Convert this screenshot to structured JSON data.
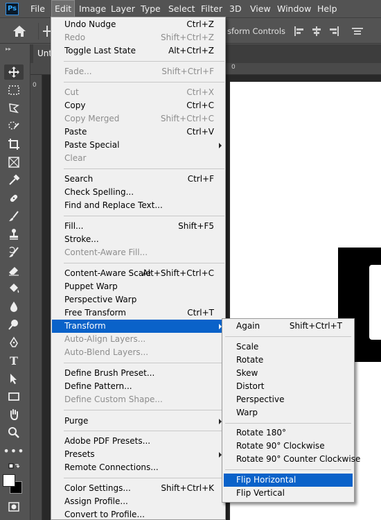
{
  "app": {
    "logo": "Ps"
  },
  "menubar": {
    "items": [
      "File",
      "Edit",
      "Image",
      "Layer",
      "Type",
      "Select",
      "Filter",
      "3D",
      "View",
      "Window",
      "Help"
    ]
  },
  "options_bar": {
    "transform_controls": "sform Controls"
  },
  "tab": {
    "title": "Unti"
  },
  "rulers": {
    "left_zero": "0",
    "top_zero": "0"
  },
  "edit_menu": {
    "items": [
      {
        "label": "Undo Nudge",
        "shortcut": "Ctrl+Z",
        "enabled": true
      },
      {
        "label": "Redo",
        "shortcut": "Shift+Ctrl+Z",
        "enabled": false
      },
      {
        "label": "Toggle Last State",
        "shortcut": "Alt+Ctrl+Z",
        "enabled": true
      },
      {
        "label": "Fade...",
        "shortcut": "Shift+Ctrl+F",
        "enabled": false
      },
      {
        "label": "Cut",
        "shortcut": "Ctrl+X",
        "enabled": false
      },
      {
        "label": "Copy",
        "shortcut": "Ctrl+C",
        "enabled": true
      },
      {
        "label": "Copy Merged",
        "shortcut": "Shift+Ctrl+C",
        "enabled": false
      },
      {
        "label": "Paste",
        "shortcut": "Ctrl+V",
        "enabled": true
      },
      {
        "label": "Paste Special",
        "shortcut": "",
        "enabled": true,
        "submenu": true
      },
      {
        "label": "Clear",
        "shortcut": "",
        "enabled": false
      },
      {
        "label": "Search",
        "shortcut": "Ctrl+F",
        "enabled": true
      },
      {
        "label": "Check Spelling...",
        "shortcut": "",
        "enabled": true
      },
      {
        "label": "Find and Replace Text...",
        "shortcut": "",
        "enabled": true
      },
      {
        "label": "Fill...",
        "shortcut": "Shift+F5",
        "enabled": true
      },
      {
        "label": "Stroke...",
        "shortcut": "",
        "enabled": true
      },
      {
        "label": "Content-Aware Fill...",
        "shortcut": "",
        "enabled": false
      },
      {
        "label": "Content-Aware Scale",
        "shortcut": "Alt+Shift+Ctrl+C",
        "enabled": true
      },
      {
        "label": "Puppet Warp",
        "shortcut": "",
        "enabled": true
      },
      {
        "label": "Perspective Warp",
        "shortcut": "",
        "enabled": true
      },
      {
        "label": "Free Transform",
        "shortcut": "Ctrl+T",
        "enabled": true
      },
      {
        "label": "Transform",
        "shortcut": "",
        "enabled": true,
        "submenu": true,
        "highlighted": true
      },
      {
        "label": "Auto-Align Layers...",
        "shortcut": "",
        "enabled": false
      },
      {
        "label": "Auto-Blend Layers...",
        "shortcut": "",
        "enabled": false
      },
      {
        "label": "Define Brush Preset...",
        "shortcut": "",
        "enabled": true
      },
      {
        "label": "Define Pattern...",
        "shortcut": "",
        "enabled": true
      },
      {
        "label": "Define Custom Shape...",
        "shortcut": "",
        "enabled": false
      },
      {
        "label": "Purge",
        "shortcut": "",
        "enabled": true,
        "submenu": true
      },
      {
        "label": "Adobe PDF Presets...",
        "shortcut": "",
        "enabled": true
      },
      {
        "label": "Presets",
        "shortcut": "",
        "enabled": true,
        "submenu": true
      },
      {
        "label": "Remote Connections...",
        "shortcut": "",
        "enabled": true
      },
      {
        "label": "Color Settings...",
        "shortcut": "Shift+Ctrl+K",
        "enabled": true
      },
      {
        "label": "Assign Profile...",
        "shortcut": "",
        "enabled": true
      },
      {
        "label": "Convert to Profile...",
        "shortcut": "",
        "enabled": true
      }
    ]
  },
  "transform_menu": {
    "items": [
      {
        "label": "Again",
        "shortcut": "Shift+Ctrl+T"
      },
      {
        "label": "Scale",
        "shortcut": ""
      },
      {
        "label": "Rotate",
        "shortcut": ""
      },
      {
        "label": "Skew",
        "shortcut": ""
      },
      {
        "label": "Distort",
        "shortcut": ""
      },
      {
        "label": "Perspective",
        "shortcut": ""
      },
      {
        "label": "Warp",
        "shortcut": ""
      },
      {
        "label": "Rotate 180°",
        "shortcut": ""
      },
      {
        "label": "Rotate 90° Clockwise",
        "shortcut": ""
      },
      {
        "label": "Rotate 90° Counter Clockwise",
        "shortcut": ""
      },
      {
        "label": "Flip Horizontal",
        "shortcut": "",
        "highlighted": true
      },
      {
        "label": "Flip Vertical",
        "shortcut": ""
      }
    ]
  },
  "tools": [
    {
      "name": "move-tool-icon",
      "selected": true
    },
    {
      "name": "rectangular-marquee-tool-icon"
    },
    {
      "name": "lasso-tool-icon"
    },
    {
      "name": "quick-selection-tool-icon"
    },
    {
      "name": "crop-tool-icon"
    },
    {
      "name": "frame-tool-icon"
    },
    {
      "name": "eyedropper-tool-icon"
    },
    {
      "name": "healing-brush-tool-icon"
    },
    {
      "name": "brush-tool-icon"
    },
    {
      "name": "clone-stamp-tool-icon"
    },
    {
      "name": "history-brush-tool-icon"
    },
    {
      "name": "eraser-tool-icon"
    },
    {
      "name": "paint-bucket-tool-icon"
    },
    {
      "name": "blur-tool-icon"
    },
    {
      "name": "dodge-tool-icon"
    },
    {
      "name": "pen-tool-icon"
    },
    {
      "name": "type-tool-icon"
    },
    {
      "name": "path-selection-tool-icon"
    },
    {
      "name": "rectangle-tool-icon"
    },
    {
      "name": "hand-tool-icon"
    },
    {
      "name": "zoom-tool-icon"
    },
    {
      "name": "more-tools-icon"
    }
  ],
  "colors": {
    "panel_bg": "#535353",
    "menu_bg": "#f0f0f0",
    "highlight": "#0a62c9",
    "disabled_text": "#8d8d8d"
  }
}
